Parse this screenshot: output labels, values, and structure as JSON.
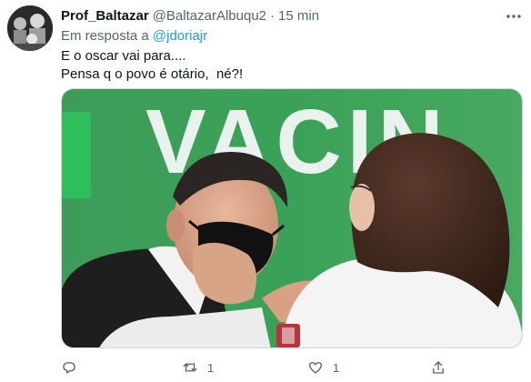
{
  "tweet": {
    "display_name": "Prof_Baltazar",
    "handle": "@BaltazarAlbuqu2",
    "separator": "·",
    "time": "15 min",
    "reply_prefix": "Em resposta a",
    "reply_mention": "@jdoriajr",
    "text_lines": [
      "E o oscar vai para....",
      "Pensa q o povo é otário,  né?!"
    ],
    "media_banner_text": "VACIN",
    "actions": {
      "reply_icon": "comment-icon",
      "retweet_icon": "retweet-icon",
      "retweet_count": "1",
      "like_icon": "heart-icon",
      "like_count": "1",
      "share_icon": "share-icon"
    }
  },
  "colors": {
    "text": "#0f1419",
    "secondary": "#536471",
    "link": "#1d9bf0",
    "banner_green": "#2f9a52"
  }
}
